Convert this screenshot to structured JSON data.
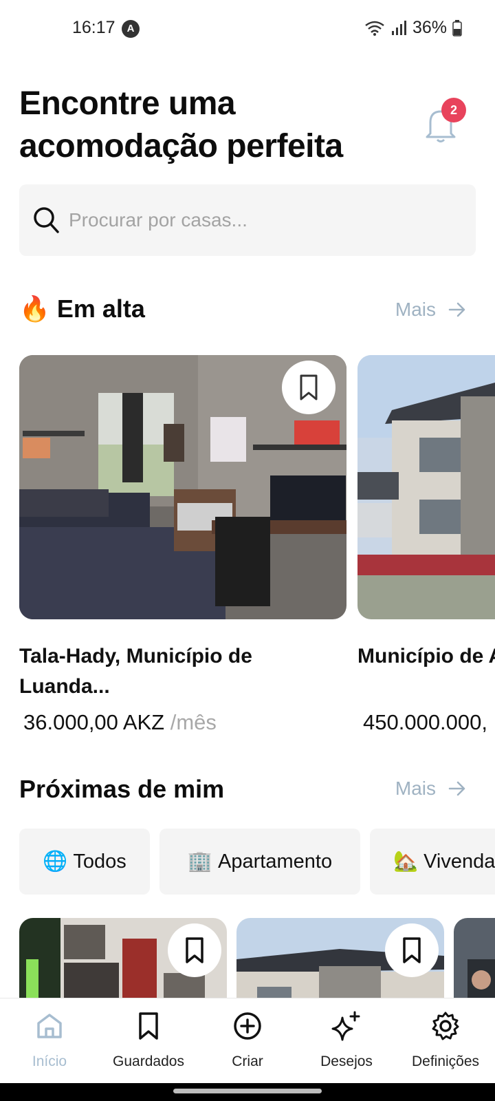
{
  "status_bar": {
    "time": "16:17",
    "app_icon": "A",
    "battery": "36%"
  },
  "header": {
    "title": "Encontre uma acomodação perfeita",
    "notification_count": "2"
  },
  "search": {
    "placeholder": "Procurar por casas..."
  },
  "trending": {
    "emoji": "🔥",
    "title": "Em alta",
    "more_label": "Mais",
    "items": [
      {
        "name": "Tala-Hady, Município de Luanda...",
        "price": "36.000,00 AKZ",
        "period": "/mês"
      },
      {
        "name": "Município de An...",
        "price": "450.000.000,",
        "period": ""
      }
    ]
  },
  "nearby": {
    "title": "Próximas de mim",
    "more_label": "Mais",
    "filters": [
      {
        "emoji": "🌐",
        "label": "Todos"
      },
      {
        "emoji": "🏢",
        "label": "Apartamento"
      },
      {
        "emoji": "🏡",
        "label": "Vivenda"
      }
    ]
  },
  "bottom_nav": {
    "items": [
      {
        "label": "Início",
        "icon": "home-icon",
        "active": true
      },
      {
        "label": "Guardados",
        "icon": "bookmark-icon",
        "active": false
      },
      {
        "label": "Criar",
        "icon": "plus-circle-icon",
        "active": false
      },
      {
        "label": "Desejos",
        "icon": "sparkles-icon",
        "active": false
      },
      {
        "label": "Definições",
        "icon": "gear-icon",
        "active": false
      }
    ]
  },
  "colors": {
    "accent_muted": "#9fb2c2",
    "badge": "#e8435c",
    "nav_active": "#a7bdd0"
  }
}
